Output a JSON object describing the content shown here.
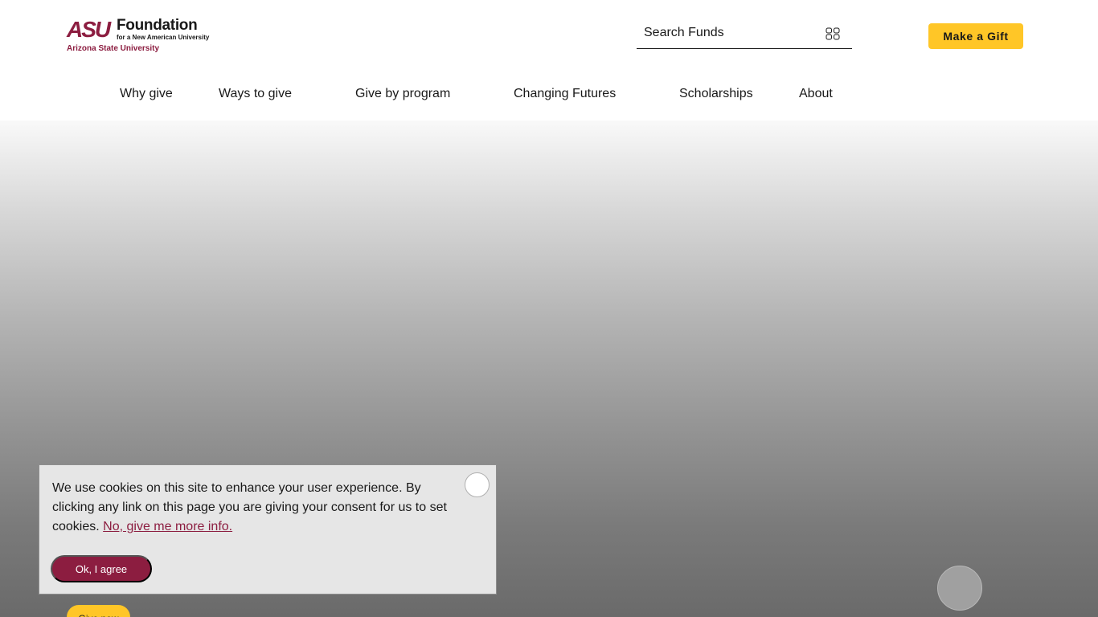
{
  "header": {
    "logo": {
      "mark": "ASU",
      "name": "Foundation",
      "tagline": "for a New American University",
      "university": "Arizona State University"
    },
    "search": {
      "placeholder": "Search Funds",
      "icon": "search-icon"
    },
    "gift_button": "Make a Gift"
  },
  "nav": {
    "items": [
      {
        "label": "Why give"
      },
      {
        "label": "Ways to give"
      },
      {
        "label": "Give by program"
      },
      {
        "label": "Changing Futures"
      },
      {
        "label": "Scholarships"
      },
      {
        "label": "About"
      }
    ]
  },
  "hero": {
    "give_now": "Give now"
  },
  "cookie_banner": {
    "message": "We use cookies on this site to enhance your user experience. By clicking any link on this page you are giving your consent for us to set cookies.",
    "more_link": "No, give me more info.",
    "agree_button": "Ok, I agree"
  },
  "colors": {
    "maroon": "#8c1d40",
    "gold": "#ffc627",
    "text": "#191919"
  }
}
